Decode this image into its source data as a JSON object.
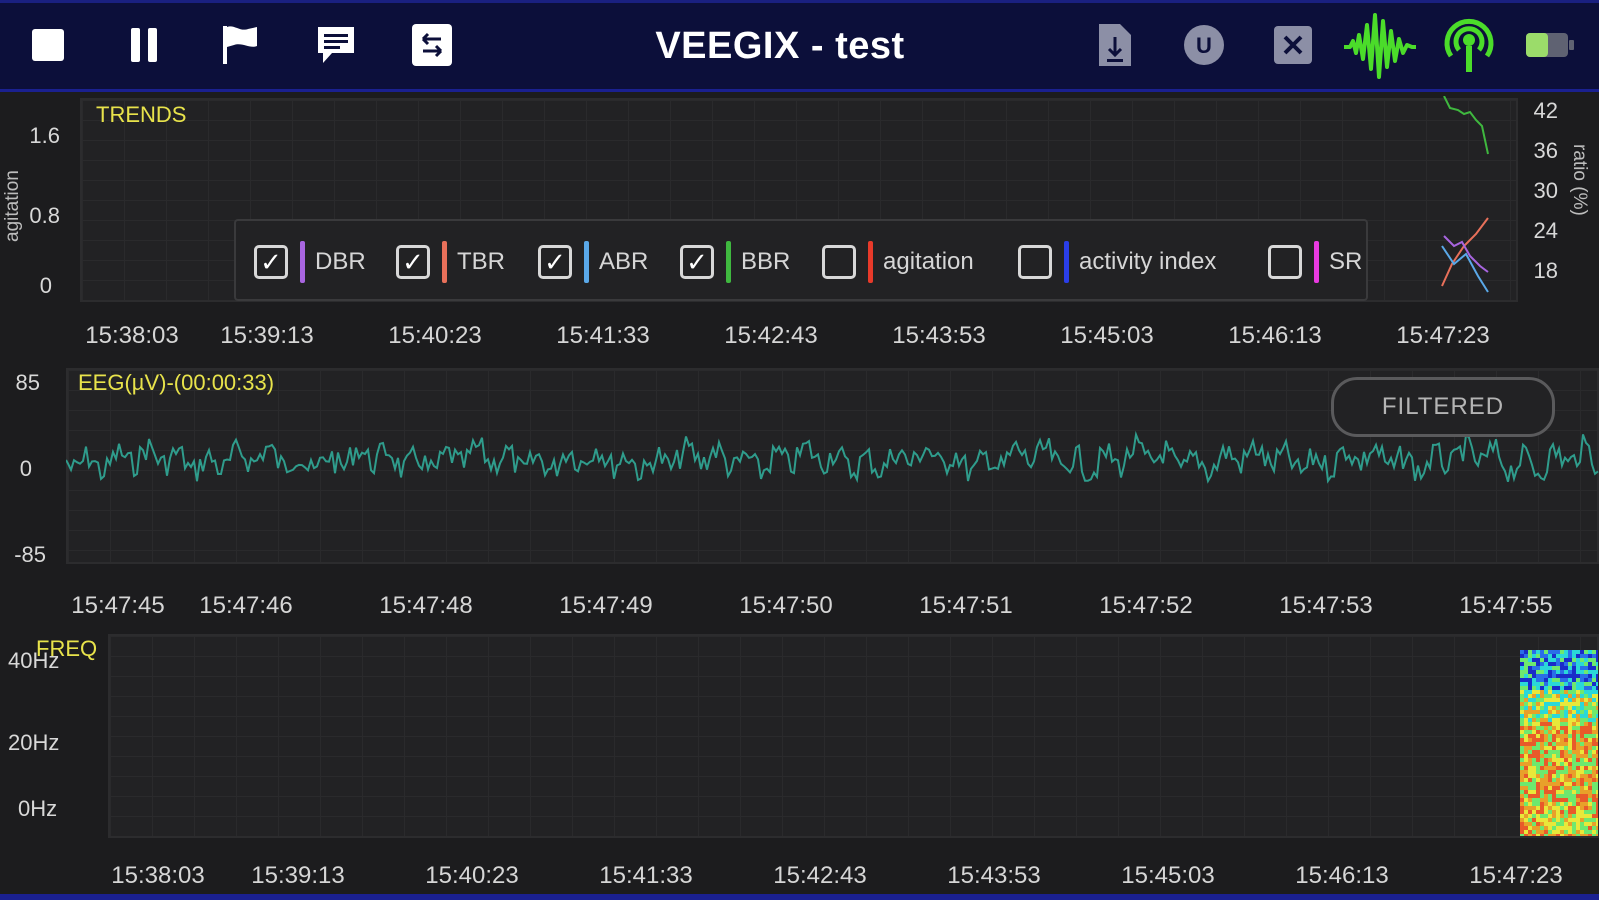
{
  "header": {
    "title": "VEEGIX - test",
    "colors": {
      "bar_bg": "#0c0f3a",
      "wave_icon": "#4bdc2a",
      "signal_icon": "#4bdc2a",
      "battery": "#9bdc6a"
    },
    "icons": [
      "stop-icon",
      "pause-icon",
      "flag-icon",
      "comment-icon",
      "swap-icon",
      "file-download-icon",
      "u-circle-icon",
      "close-box-icon",
      "eeg-wave-icon",
      "signal-icon",
      "battery-icon"
    ]
  },
  "trends": {
    "title": "TRENDS",
    "left_axis_label": "agitation",
    "left_ticks": [
      "1.6",
      "0.8",
      "0"
    ],
    "right_axis_label": "ratio (%)",
    "right_ticks": [
      "42",
      "36",
      "30",
      "24",
      "18"
    ],
    "x_ticks": [
      "15:38:03",
      "15:39:13",
      "15:40:23",
      "15:41:33",
      "15:42:43",
      "15:43:53",
      "15:45:03",
      "15:46:13",
      "15:47:23"
    ],
    "legend": [
      {
        "label": "DBR",
        "checked": true,
        "color": "#a865e0"
      },
      {
        "label": "TBR",
        "checked": true,
        "color": "#e8705a"
      },
      {
        "label": "ABR",
        "checked": true,
        "color": "#5aa8e8"
      },
      {
        "label": "BBR",
        "checked": true,
        "color": "#3fb83f"
      },
      {
        "label": "agitation",
        "checked": false,
        "color": "#e83a2a"
      },
      {
        "label": "activity index",
        "checked": false,
        "color": "#2a3ee8"
      },
      {
        "label": "SR",
        "checked": false,
        "color": "#e83ae0"
      }
    ],
    "checkmark": "✓"
  },
  "eeg": {
    "title": "EEG(µV)-(00:00:33)",
    "y_ticks": [
      "85",
      "0",
      "-85"
    ],
    "x_ticks": [
      "15:47:45",
      "15:47:46",
      "15:47:48",
      "15:47:49",
      "15:47:50",
      "15:47:51",
      "15:47:52",
      "15:47:53",
      "15:47:55"
    ],
    "filter_button": "FILTERED",
    "trace_color": "#2f9c8c"
  },
  "freq": {
    "title": "FREQ",
    "y_ticks": [
      "40Hz",
      "20Hz",
      "0Hz"
    ],
    "x_ticks": [
      "15:38:03",
      "15:39:13",
      "15:40:23",
      "15:41:33",
      "15:42:43",
      "15:43:53",
      "15:45:03",
      "15:46:13",
      "15:47:23"
    ]
  }
}
